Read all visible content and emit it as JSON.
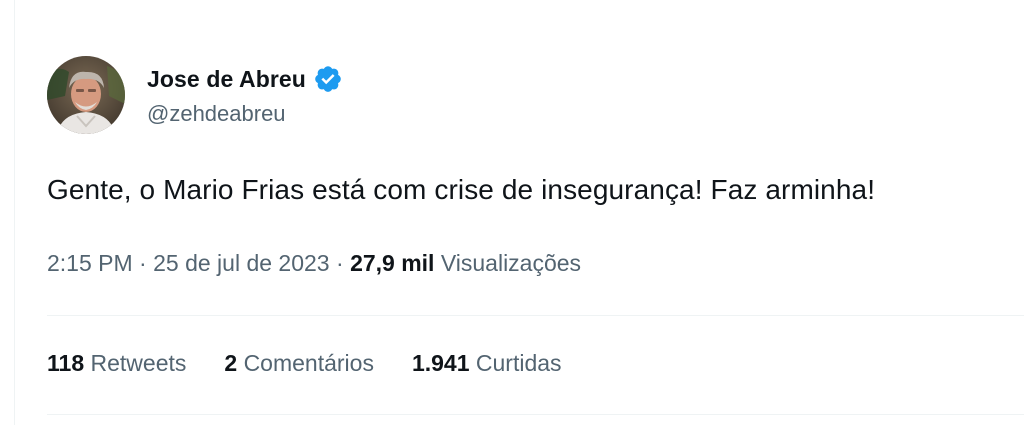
{
  "author": {
    "display_name": "Jose de Abreu",
    "handle": "@zehdeabreu",
    "verified_color": "#1d9bf0"
  },
  "tweet": {
    "text": "Gente, o Mario Frias está com crise de insegurança! Faz arminha!",
    "time": "2:15 PM",
    "separator": "·",
    "date": "25 de jul de 2023",
    "views_count": "27,9 mil",
    "views_label": "Visualizações"
  },
  "stats": [
    {
      "count": "118",
      "label": "Retweets"
    },
    {
      "count": "2",
      "label": "Comentários"
    },
    {
      "count": "1.941",
      "label": "Curtidas"
    }
  ],
  "colors": {
    "text_primary": "#0f1419",
    "text_secondary": "#536471",
    "divider": "#eff3f4"
  }
}
